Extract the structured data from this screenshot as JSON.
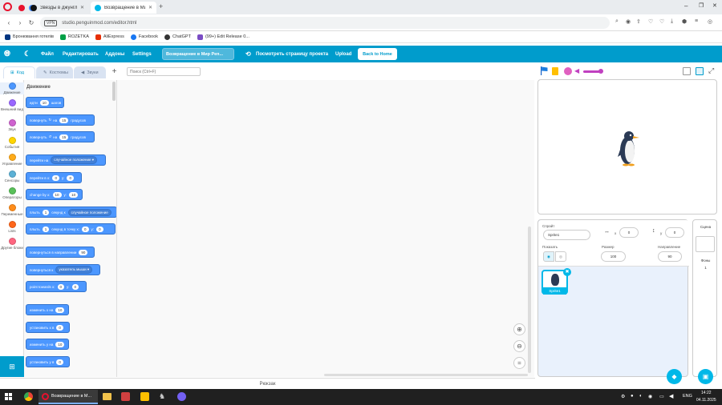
{
  "browser": {
    "tabs": [
      {
        "label": "",
        "color": "#e8112d"
      },
      {
        "label": "",
        "color": "#4285f4"
      },
      {
        "label": "Звезды в джунглях 1 - 2 ...",
        "color": "#111111"
      },
      {
        "label": "Возвращение в Мир Реп...",
        "color": "#00b8e8"
      }
    ],
    "url": "studio.penguinmod.com/editor.html",
    "vpn": "VPN",
    "bookmarks": [
      "Бронювання готелів",
      "ROZETKA",
      "AliExpress",
      "Facebook",
      "ChatGPT",
      "(99+) Edit Release 0..."
    ]
  },
  "menu": {
    "file": "Файл",
    "edit": "Редактировать",
    "addons": "Аддоны",
    "settings": "Settings",
    "project_name": "Возвращение в Мир Реп...",
    "see_project": "Посмотреть страницу проекта",
    "upload": "Upload",
    "back_home": "Back to Home"
  },
  "editor_tabs": {
    "code": "Код",
    "costumes": "Костюмы",
    "sounds": "Звуки"
  },
  "search": {
    "placeholder": "Поиск (Ctrl+F)"
  },
  "categories": [
    {
      "label": "Движение",
      "color": "#4c97ff"
    },
    {
      "label": "Внешний вид",
      "color": "#9966ff"
    },
    {
      "label": "Звук",
      "color": "#cf63cf"
    },
    {
      "label": "События",
      "color": "#ffd500"
    },
    {
      "label": "Управление",
      "color": "#ffab19"
    },
    {
      "label": "Сенсоры",
      "color": "#5cb1d6"
    },
    {
      "label": "Операторы",
      "color": "#59c059"
    },
    {
      "label": "Переменные",
      "color": "#ff8c1a"
    },
    {
      "label": "Lists",
      "color": "#ff661a"
    },
    {
      "label": "Другие блоки",
      "color": "#ff6680"
    }
  ],
  "palette": {
    "heading": "Движение",
    "move": {
      "a": "идти",
      "v": "10",
      "b": "шагов"
    },
    "turn_right": {
      "a": "повернуть",
      "b": "на",
      "v": "15",
      "c": "градусов"
    },
    "turn_left": {
      "a": "повернуть",
      "b": "на",
      "v": "15",
      "c": "градусов"
    },
    "goto": {
      "a": "перейти на",
      "d": "случайное положение ▾"
    },
    "goto_xy": {
      "a": "перейти в x:",
      "x": "0",
      "b": "y:",
      "y": "0"
    },
    "change_by": {
      "a": "change by x:",
      "x": "10",
      "b": "y:",
      "y": "10"
    },
    "glide": {
      "a": "плыть",
      "v": "1",
      "b": "секунд к",
      "d": "случайное положение"
    },
    "glide_xy": {
      "a": "плыть",
      "v": "1",
      "b": "секунд в точку x:",
      "x": "0",
      "c": "y:",
      "y": "0"
    },
    "point_dir": {
      "a": "повернуться в направлении",
      "v": "90"
    },
    "point_to": {
      "a": "повернуться к",
      "d": "указатель мыши ▾"
    },
    "point_towards": {
      "a": "point towards x:",
      "x": "0",
      "b": "y:",
      "y": "0"
    },
    "change_x": {
      "a": "изменить x на",
      "v": "10"
    },
    "set_x": {
      "a": "установить x в",
      "v": "0"
    },
    "change_y": {
      "a": "изменить y на",
      "v": "10"
    },
    "set_y": {
      "a": "установить y в",
      "v": "0"
    }
  },
  "sprite_info": {
    "sprite_label": "Спрайт",
    "sprite_name": "Sprite1",
    "x_label": "x",
    "x_value": "0",
    "y_label": "y",
    "y_value": "0",
    "show_label": "Показать",
    "size_label": "Размер",
    "size_value": "100",
    "direction_label": "Направление",
    "direction_value": "90"
  },
  "sprite_tile": {
    "name": "Sprite1"
  },
  "stage_pane": {
    "title": "Сцена",
    "backdrops_label": "Фоны",
    "backdrops_count": "1"
  },
  "backpack": "Рюкзак",
  "taskbar": {
    "active_app": "Возвращение в М...",
    "language": "ENG",
    "time": "14:22",
    "date": "04.11.2025"
  }
}
